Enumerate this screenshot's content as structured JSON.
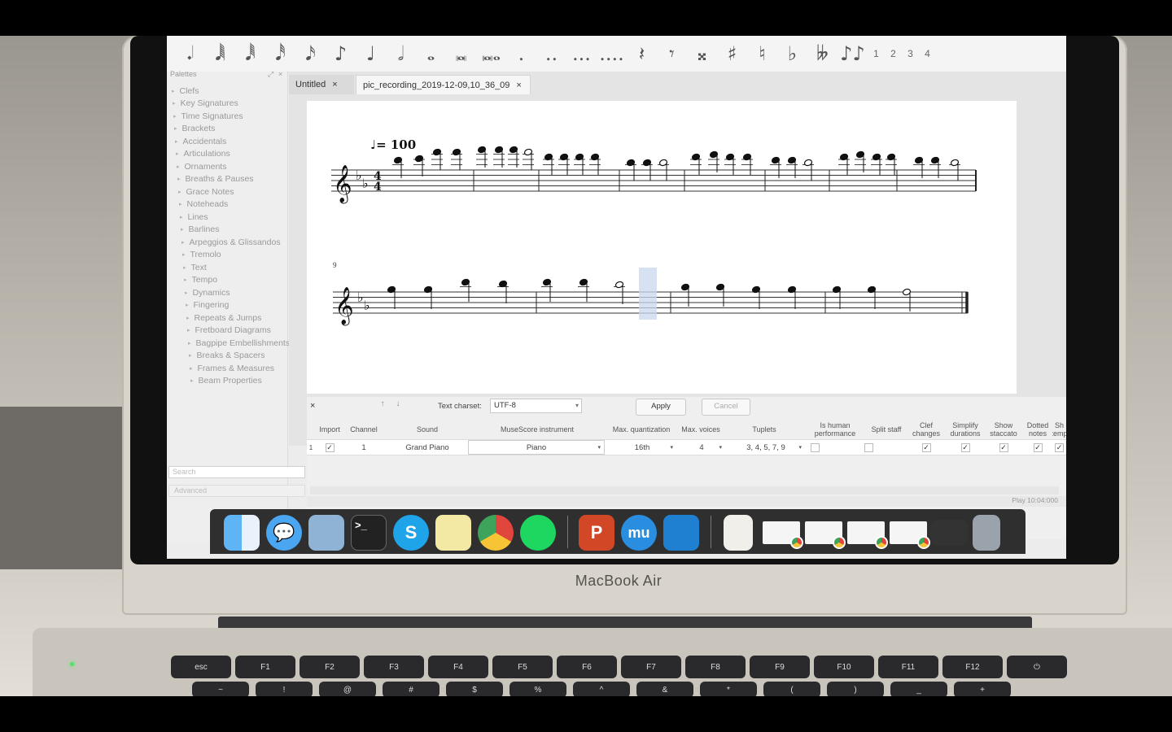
{
  "note_toolbar": {
    "items": [
      "𝆺𝅥",
      "𝅘𝅥𝅲",
      "𝅘𝅥𝅱",
      "𝅘𝅥𝅰",
      "𝅘𝅥𝅯",
      "♪",
      "♩",
      "𝅗𝅥",
      "𝅝",
      "𝅜",
      "𝅜𝅝",
      ".",
      "..",
      "...",
      "....",
      "𝄽",
      "𝄾",
      "𝄪",
      "♯",
      "♮",
      "♭",
      "𝄫",
      "♪♪"
    ],
    "voices": [
      "1",
      "2",
      "3",
      "4"
    ]
  },
  "palettes": {
    "title": "Palettes",
    "items": [
      "Clefs",
      "Key Signatures",
      "Time Signatures",
      "Brackets",
      "Accidentals",
      "Articulations",
      "Ornaments",
      "Breaths & Pauses",
      "Grace Notes",
      "Noteheads",
      "Lines",
      "Barlines",
      "Arpeggios & Glissandos",
      "Tremolo",
      "Text",
      "Tempo",
      "Dynamics",
      "Fingering",
      "Repeats & Jumps",
      "Fretboard Diagrams",
      "Bagpipe Embellishments",
      "Breaks & Spacers",
      "Frames & Measures",
      "Beam Properties"
    ],
    "search_placeholder": "Search",
    "advanced": "Advanced"
  },
  "tabs": [
    {
      "label": "Untitled"
    },
    {
      "label": "pic_recording_2019-12-09,10_36_09"
    }
  ],
  "score": {
    "tempo_text": "♩= 100",
    "measure_number_system2": "9",
    "time_signature": "4/4",
    "key_signature": "2 flats"
  },
  "import_panel": {
    "close": "×",
    "up": "↑",
    "down": "↓",
    "charset_label": "Text charset:",
    "charset_value": "UTF-8",
    "apply": "Apply",
    "cancel": "Cancel",
    "headers": {
      "import": "Import",
      "channel": "Channel",
      "sound": "Sound",
      "instrument": "MuseScore instrument",
      "max_quant": "Max. quantization",
      "max_voices": "Max. voices",
      "tuplets": "Tuplets",
      "human_1": "Is human",
      "human_2": "performance",
      "split": "Split staff",
      "clef_1": "Clef",
      "clef_2": "changes",
      "simplify_1": "Simplify",
      "simplify_2": "durations",
      "staccato_1": "Show",
      "staccato_2": "staccato",
      "dotted_1": "Dotted",
      "dotted_2": "notes",
      "tempo_1": "Sh",
      "tempo_2": "temp"
    },
    "row": {
      "index": "1",
      "import": "✓",
      "channel": "1",
      "sound": "Grand Piano",
      "instrument": "Piano",
      "max_quant": "16th",
      "max_voices": "4",
      "tuplets": "3, 4, 5, 7, 9",
      "check": "✓"
    }
  },
  "status": {
    "text": "Play   10:04:000"
  },
  "dock": {
    "apps": [
      "finder-icon",
      "messages-icon",
      "preview-icon",
      "terminal-icon",
      "skype-icon",
      "stickies-icon",
      "chrome-icon",
      "spotify-icon",
      "powerpoint-icon",
      "musescore-icon",
      "vscode-icon",
      "document-icon",
      "trash-icon"
    ],
    "terminal_glyph": ">_",
    "skype_glyph": "S",
    "powerpoint_glyph": "P",
    "musescore_glyph": "mu"
  },
  "laptop": {
    "brand": "MacBook Air"
  },
  "keyboard": {
    "keys": [
      "esc",
      "F1",
      "F2",
      "F3",
      "F4",
      "F5",
      "F6",
      "F7",
      "F8",
      "F9",
      "F10",
      "F11",
      "F12",
      "⏻"
    ],
    "row2": [
      "~",
      "!",
      "@",
      "#",
      "$",
      "%",
      "^",
      "&",
      "*",
      "(",
      ")",
      "_",
      "+"
    ]
  }
}
